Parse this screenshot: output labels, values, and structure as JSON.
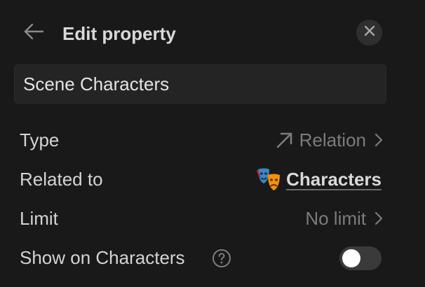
{
  "header": {
    "title": "Edit property",
    "back_icon": "arrow-left-icon",
    "close_icon": "close-icon"
  },
  "name_field": {
    "value": "Scene Characters"
  },
  "rows": {
    "type": {
      "label": "Type",
      "value": "Relation",
      "icon": "arrow-up-right-icon"
    },
    "related_to": {
      "label": "Related to",
      "value": "Characters",
      "icon": "performing-arts-emoji"
    },
    "limit": {
      "label": "Limit",
      "value": "No limit"
    },
    "show_on": {
      "label": "Show on Characters",
      "help_icon": "question-circle-icon",
      "toggle_on": false
    }
  },
  "colors": {
    "background": "#191919",
    "input_bg": "#242424",
    "muted_text": "#7c7c7c",
    "text": "#d4d4d4",
    "toggle_off": "#3a3a3a"
  }
}
